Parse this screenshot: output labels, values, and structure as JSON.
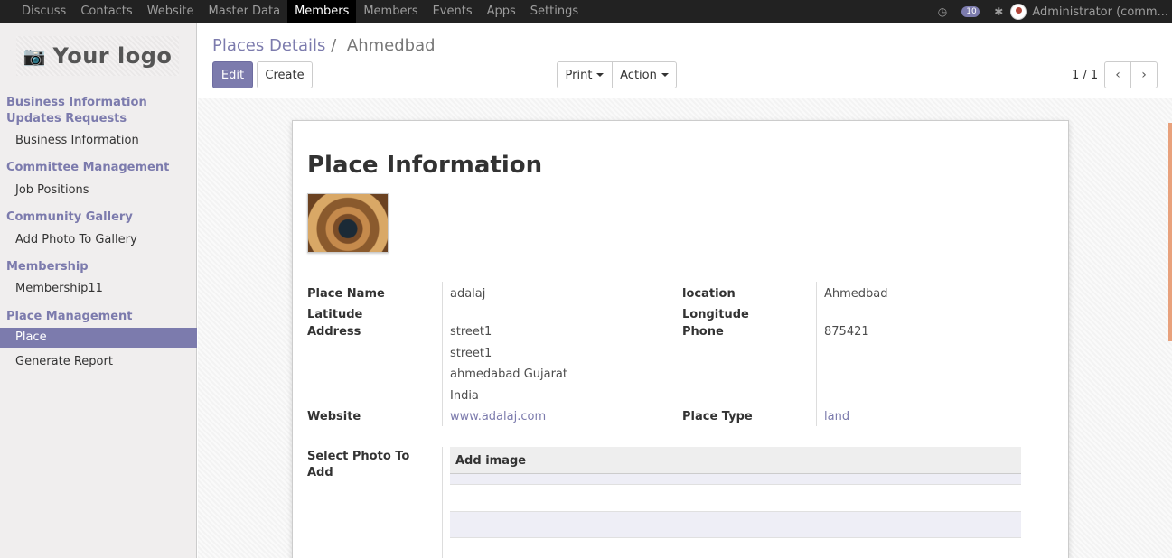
{
  "topnav": {
    "items": [
      "Discuss",
      "Contacts",
      "Website",
      "Master Data",
      "Members",
      "Members",
      "Events",
      "Apps",
      "Settings"
    ],
    "active_index": 4,
    "message_count": "10",
    "user": "Administrator (comm..."
  },
  "sidebar": {
    "logo_text": "Your logo",
    "sections": [
      {
        "title_line1": "Business Information",
        "title_line2": "Updates Requests",
        "items": [
          "Business Information"
        ]
      },
      {
        "title_line1": "Committee Management",
        "items": [
          "Job Positions"
        ]
      },
      {
        "title_line1": "Community Gallery",
        "items": [
          "Add Photo To Gallery"
        ]
      },
      {
        "title_line1": "Membership",
        "items": [
          "Membership11"
        ]
      },
      {
        "title_line1": "Place Management",
        "items": [
          "Place",
          "Generate Report"
        ]
      }
    ],
    "active_item": "Place"
  },
  "breadcrumb": {
    "parent": "Places Details",
    "separator": "/",
    "current": "Ahmedbad"
  },
  "toolbar": {
    "edit_label": "Edit",
    "create_label": "Create",
    "print_label": "Print",
    "action_label": "Action"
  },
  "pager": {
    "value": "1 / 1"
  },
  "form": {
    "title": "Place Information",
    "fields": {
      "place_name_label": "Place Name",
      "place_name": "adalaj",
      "location_label": "location",
      "location": "Ahmedbad",
      "latitude_label": "Latitude",
      "latitude": "",
      "longitude_label": "Longitude",
      "longitude": "",
      "address_label": "Address",
      "address_lines": [
        "street1",
        "street1",
        "ahmedabad Gujarat",
        "India"
      ],
      "phone_label": "Phone",
      "phone": "875421",
      "website_label": "Website",
      "website": "www.adalaj.com",
      "place_type_label": "Place Type",
      "place_type": "land",
      "photos_label_line1": "Select Photo To",
      "photos_label_line2": "Add",
      "photos_column": "Add image"
    }
  },
  "colors": {
    "brand": "#7c7bad",
    "topbar": "#222222",
    "sidebar_bg": "#f0eeee"
  }
}
